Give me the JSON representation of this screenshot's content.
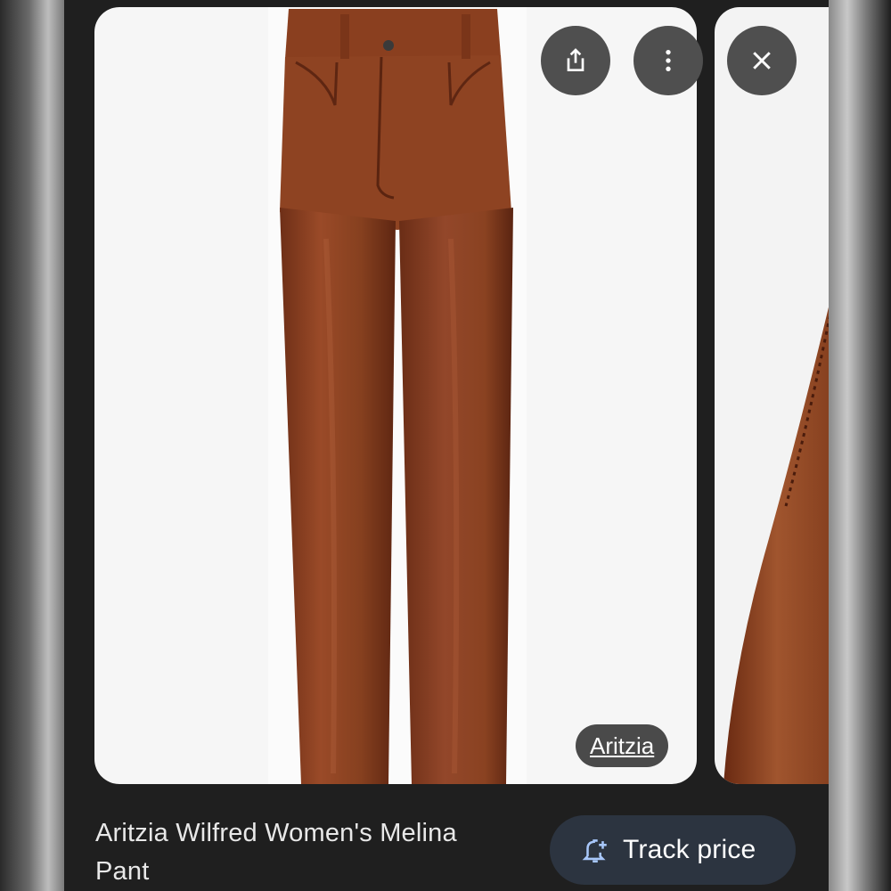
{
  "actions": {
    "share_icon": "share-icon",
    "more_icon": "more-vert-icon",
    "close_icon": "close-icon"
  },
  "image": {
    "source_label": "Aritzia"
  },
  "product": {
    "title": "Aritzia Wilfred Women's Melina Pant"
  },
  "track_price": {
    "icon": "bell-plus-icon",
    "label": "Track price"
  },
  "colors": {
    "background": "#1f1f1f",
    "card": "#f6f6f6",
    "button": "#4f4f4f",
    "track_button": "#2c3440",
    "track_icon": "#a8c7fa",
    "leather": "#8b3f20"
  }
}
